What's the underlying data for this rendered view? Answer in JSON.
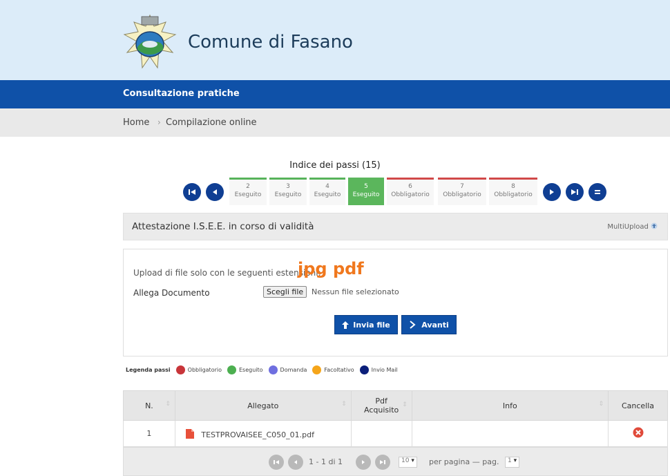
{
  "header": {
    "site_title": "Comune di Fasano"
  },
  "bar": {
    "title": "Consultazione pratiche"
  },
  "breadcrumb": {
    "home": "Home",
    "sep": "›",
    "current": "Compilazione online"
  },
  "steps": {
    "title": "Indice dei passi (15)",
    "items": [
      {
        "num": "2",
        "label": "Eseguito",
        "state": "done"
      },
      {
        "num": "3",
        "label": "Eseguito",
        "state": "done"
      },
      {
        "num": "4",
        "label": "Eseguito",
        "state": "done"
      },
      {
        "num": "5",
        "label": "Eseguito",
        "state": "current"
      },
      {
        "num": "6",
        "label": "Obbligatorio",
        "state": "required"
      },
      {
        "num": "7",
        "label": "Obbligatorio",
        "state": "required"
      },
      {
        "num": "8",
        "label": "Obbligatorio",
        "state": "required"
      }
    ]
  },
  "panel": {
    "title": "Attestazione I.S.E.E. in corso di validità",
    "multiupload": "MultiUpload",
    "upload_text": "Upload di file solo con le seguenti estensioni:",
    "extensions": "jpg pdf",
    "allega_label": "Allega Documento",
    "choose_file": "Scegli file",
    "no_file": "Nessun file selezionato",
    "send_btn": "Invia file",
    "next_btn": "Avanti"
  },
  "legend": {
    "title": "Legenda passi",
    "items": [
      {
        "label": "Obbligatorio",
        "color": "#c8353a"
      },
      {
        "label": "Eseguito",
        "color": "#4caf50"
      },
      {
        "label": "Domanda",
        "color": "#6f6fe0"
      },
      {
        "label": "Facoltativo",
        "color": "#f5a51a"
      },
      {
        "label": "Invio Mail",
        "color": "#0b1f7a"
      }
    ]
  },
  "table": {
    "headers": {
      "n": "N.",
      "allegato": "Allegato",
      "pdf": "Pdf Acquisito",
      "info": "Info",
      "cancella": "Cancella"
    },
    "rows": [
      {
        "n": "1",
        "file": "TESTPROVAISEE_C050_01.pdf",
        "pdf": "",
        "info": ""
      }
    ]
  },
  "pager": {
    "range": "1 - 1 di 1",
    "per_page_value": "10",
    "per_page_label": "per pagina — pag.",
    "page_value": "1"
  }
}
